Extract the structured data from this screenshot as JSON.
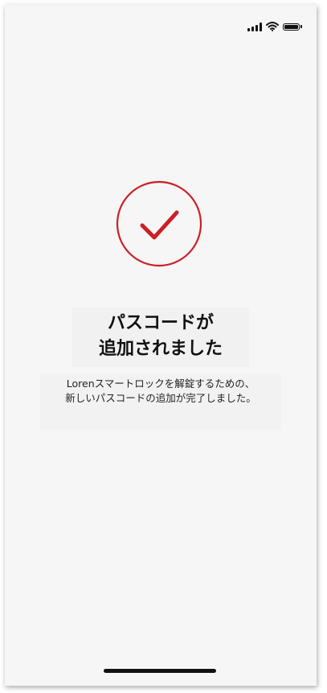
{
  "status_bar": {
    "signal_icon": "cellular-signal-icon",
    "wifi_icon": "wifi-icon",
    "battery_icon": "battery-icon"
  },
  "success": {
    "icon": "checkmark-circle-icon",
    "accent_color": "#cc1f26",
    "title_line1": "パスコードが",
    "title_line2": "追加されました",
    "description_line1": "Lorenスマートロックを解錠するための、",
    "description_line2": "新しいパスコードの追加が完了しました。"
  },
  "home_indicator": "home-indicator"
}
